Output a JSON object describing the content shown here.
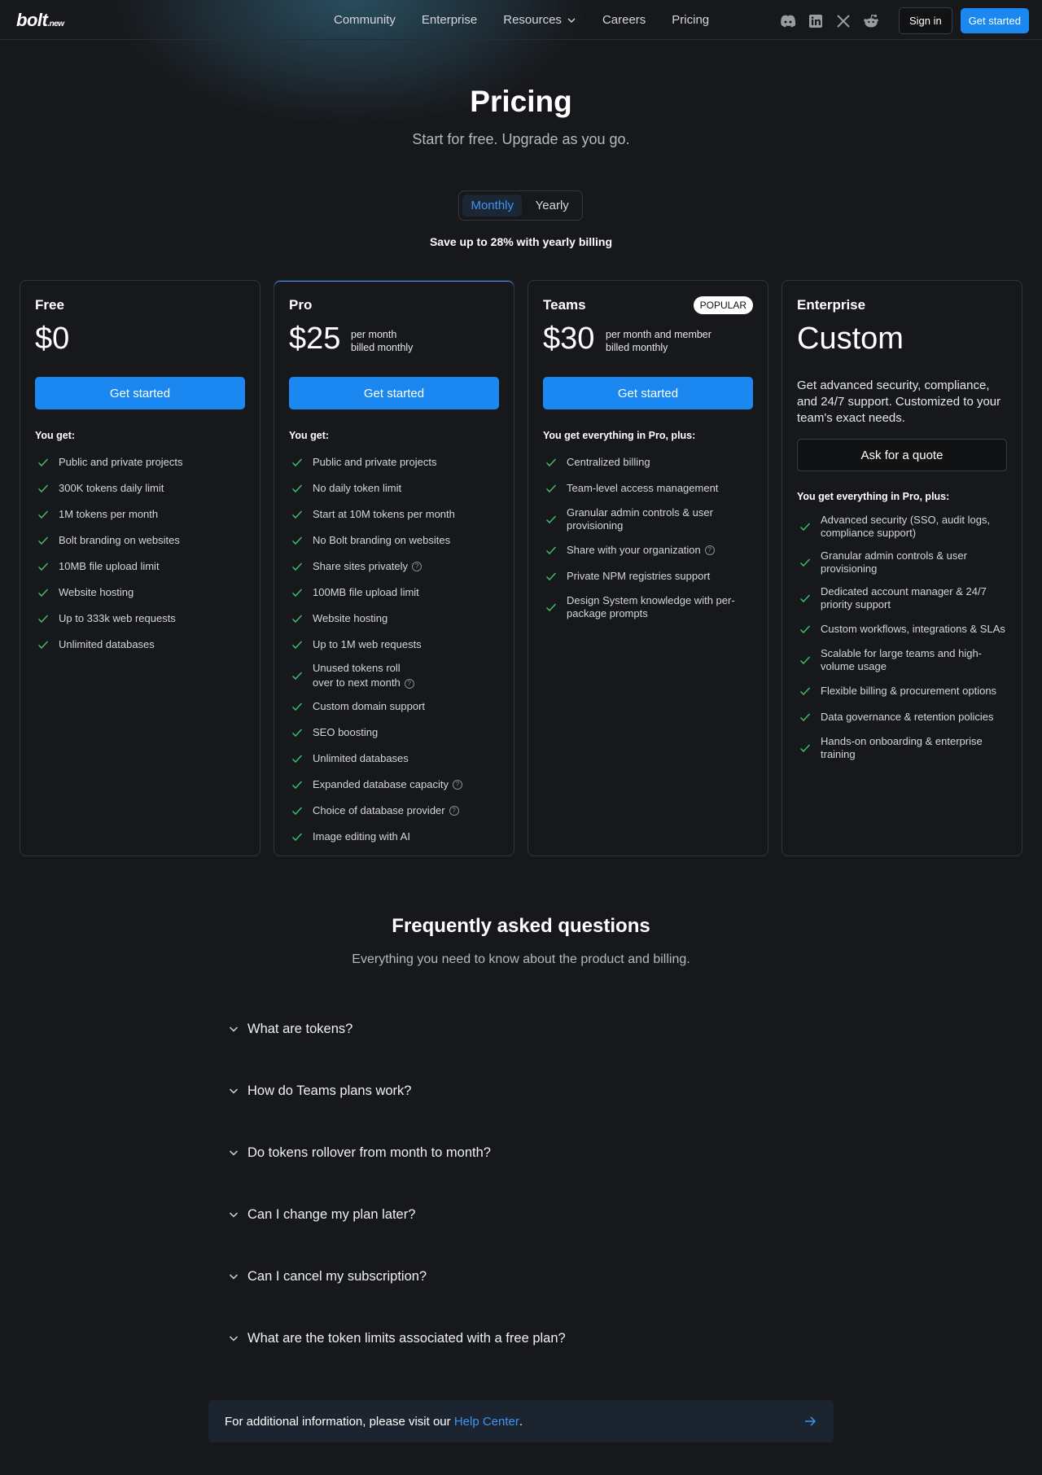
{
  "nav": {
    "logo_main": "bolt",
    "logo_suffix": ".new",
    "links": [
      "Community",
      "Enterprise",
      "Resources",
      "Careers",
      "Pricing"
    ],
    "social_icons": [
      "discord-icon",
      "linkedin-icon",
      "x-icon",
      "reddit-icon"
    ],
    "sign_in": "Sign in",
    "get_started": "Get started"
  },
  "hero": {
    "title": "Pricing",
    "subtitle": "Start for free. Upgrade as you go.",
    "toggle": {
      "monthly": "Monthly",
      "yearly": "Yearly",
      "selected": "Monthly"
    },
    "save_note": "Save up to 28% with yearly billing"
  },
  "plans": [
    {
      "name": "Free",
      "price": "$0",
      "price_note": "",
      "badge": "",
      "cta": "Get started",
      "features_heading": "You get:",
      "features": [
        "Public and private projects",
        "300K tokens daily limit",
        "1M tokens per month",
        "Bolt branding on websites",
        "10MB file upload limit",
        "Website hosting",
        "Up to 333k web requests",
        "Unlimited databases"
      ]
    },
    {
      "name": "Pro",
      "price": "$25",
      "price_note_1": "per month",
      "price_note_2": "billed monthly",
      "cta": "Get started",
      "features_heading": "You get:",
      "features": [
        "Public and private projects",
        "No daily token limit",
        "Start at 10M tokens per month",
        "No Bolt branding on websites",
        "Share sites privately",
        "100MB file upload limit",
        "Website hosting",
        "Up to 1M web requests",
        "Unused tokens roll",
        "over to next month",
        "Custom domain support",
        "SEO boosting",
        "Unlimited databases",
        "Expanded database capacity",
        "Choice of database provider",
        "Image editing with AI"
      ]
    },
    {
      "name": "Teams",
      "price": "$30",
      "price_note_1": "per month and member",
      "price_note_2": "billed monthly",
      "badge": "POPULAR",
      "cta": "Get started",
      "features_heading": "You get everything in Pro, plus:",
      "features": [
        "Centralized billing",
        "Team-level access management",
        "Granular admin controls & user",
        "provisioning",
        "Share with your organization",
        "Private NPM registries support",
        "Design System knowledge with per-",
        "package prompts"
      ]
    },
    {
      "name": "Enterprise",
      "price": "Custom",
      "description": "Get advanced security, compliance, and 24/7 support. Customized to your team's exact needs.",
      "cta": "Ask for a quote",
      "features_heading": "You get everything in Pro, plus:",
      "features": [
        "Advanced security (SSO, audit logs,",
        "compliance support)",
        "Granular admin controls & user",
        "provisioning",
        "Dedicated account manager & 24/7",
        "priority support",
        "Custom workflows, integrations & SLAs",
        "Scalable for large teams and high-",
        "volume usage",
        "Flexible billing & procurement options",
        "Data governance & retention policies",
        "Hands-on onboarding & enterprise",
        "training"
      ]
    }
  ],
  "faq": {
    "title": "Frequently asked questions",
    "subtitle": "Everything you need to know about the product and billing.",
    "questions": [
      "What are tokens?",
      "How do Teams plans work?",
      "Do tokens rollover from month to month?",
      "Can I change my plan later?",
      "Can I cancel my subscription?",
      "What are the token limits associated with a free plan?"
    ]
  },
  "footer_info": {
    "text": "For additional information, please visit our ",
    "link": "Help Center",
    "end": "."
  },
  "colors": {
    "accent": "#1a88f0",
    "check": "#3dbb6b",
    "background": "#17181b"
  }
}
